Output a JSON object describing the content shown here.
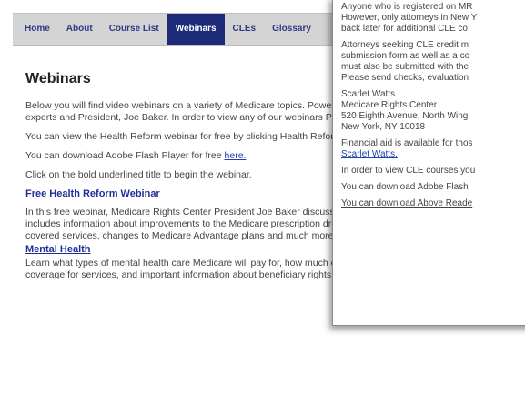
{
  "nav": {
    "items": [
      {
        "label": "Home",
        "active": false
      },
      {
        "label": "About",
        "active": false
      },
      {
        "label": "Course List",
        "active": false
      },
      {
        "label": "Webinars",
        "active": true
      },
      {
        "label": "CLEs",
        "active": false
      },
      {
        "label": "Glossary",
        "active": false
      }
    ]
  },
  "main": {
    "title": "Webinars",
    "intro": "Below you will find video webinars on a variety of Medicare topics. PowerPoint slide shows narrated by our Medicare experts and President, Joe Baker. In order to view any of our webinars Player.",
    "health_reform_text": "You can view the Health Reform webinar for free by clicking Health Reform Webinar.",
    "flash_text": "You can download Adobe Flash Player for free ",
    "flash_link": "here.",
    "click_text": "Click on the bold underlined title to begin the webinar.",
    "webinar1_title": "Free Health Reform Webinar",
    "webinar1_desc": "In this free webinar, Medicare Rights Center President Joe Baker discusses the Affordable Care Act. The webinar includes information about improvements to the Medicare prescription drug benefit, the expansion of Medicare-covered services, changes to Medicare Advantage plans and much more.",
    "webinar2_title": "Mental Health",
    "webinar2_desc": "Learn what types of mental health care Medicare will pay for, how much of the cost Medicare will cover, how to seek coverage for services, and important information about beneficiary rights."
  },
  "panel": {
    "para1": [
      "Anyone who is registered on MR",
      "However, only attorneys in New Y",
      "back later for additional CLE co"
    ],
    "para2": [
      "Attorneys seeking CLE credit m",
      "submission form as well as a co",
      "must also be submitted with the",
      "Please send checks, evaluation"
    ],
    "address": [
      "Scarlet Watts",
      "Medicare Rights Center",
      "520 Eighth Avenue, North Wing",
      "New York, NY 10018"
    ],
    "aid_text": "Financial aid is available for thos",
    "aid_link": "Scarlet Watts.",
    "cle_text": "In order to view CLE courses you",
    "flash_text": "You can download Adobe Flash",
    "reader_text": "You can download Above Reade"
  }
}
